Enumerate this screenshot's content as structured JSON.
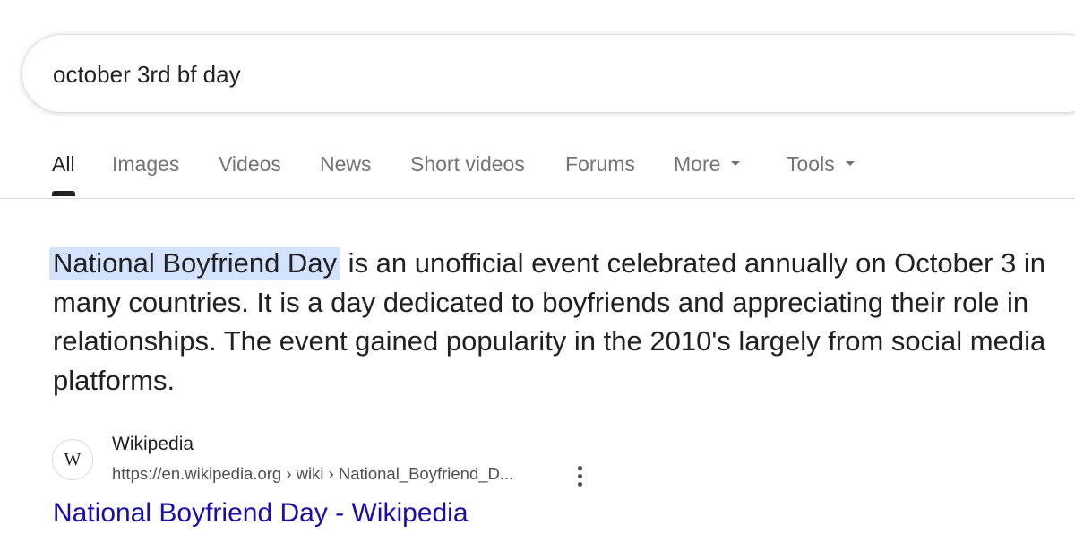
{
  "search": {
    "query": "october 3rd bf day"
  },
  "tabs": [
    {
      "label": "All",
      "active": true
    },
    {
      "label": "Images"
    },
    {
      "label": "Videos"
    },
    {
      "label": "News"
    },
    {
      "label": "Short videos"
    },
    {
      "label": "Forums"
    },
    {
      "label": "More",
      "has_dropdown": true
    },
    {
      "label": "Tools",
      "has_dropdown": true
    }
  ],
  "featured_snippet": {
    "highlight": "National Boyfriend Day",
    "text": " is an unofficial event celebrated annually on October 3 in many countries. It is a day dedicated to boyfriends and appreciating their role in relationships. The event gained popularity in the 2010's largely from social media platforms."
  },
  "source": {
    "favicon_letter": "W",
    "name": "Wikipedia",
    "url": "https://en.wikipedia.org › wiki › National_Boyfriend_D...",
    "title": "National Boyfriend Day - Wikipedia"
  },
  "colors": {
    "link": "#1a0dab",
    "highlight": "#d3e3fd",
    "tab_inactive": "#70757a",
    "text": "#202124"
  },
  "icons": {
    "tab_dropdown": "chevron-down-icon",
    "result_menu": "more-vert-icon"
  }
}
